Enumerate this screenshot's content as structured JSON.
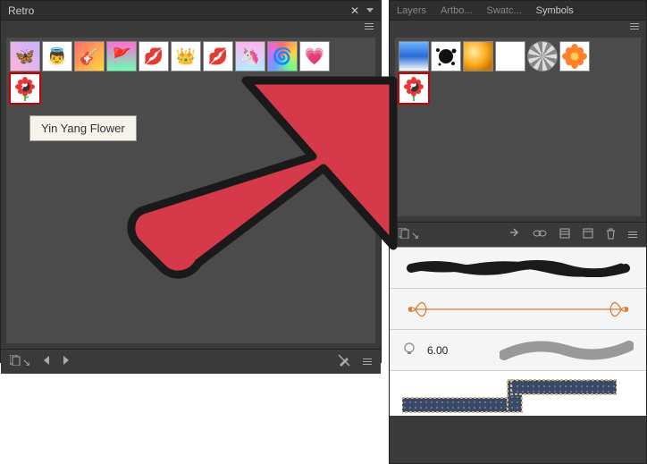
{
  "left_panel": {
    "title": "Retro",
    "tooltip": "Yin Yang Flower",
    "thumbs": [
      "butterfly",
      "angel",
      "guitar",
      "pennant",
      "lips-pink",
      "tiara",
      "lips-red",
      "unicorn",
      "spiral",
      "heart-wings",
      "yin-yang-flower"
    ]
  },
  "right_panel": {
    "tabs": [
      "Layers",
      "Artbo...",
      "Swatc...",
      "Symbols"
    ],
    "active_tab": 3,
    "thumbs": [
      "gradient-blue",
      "ink-splat",
      "orange-sphere",
      "blank",
      "chain-ring",
      "flower-orange",
      "yin-yang-flower"
    ]
  },
  "stroke": {
    "value": "6.00"
  }
}
